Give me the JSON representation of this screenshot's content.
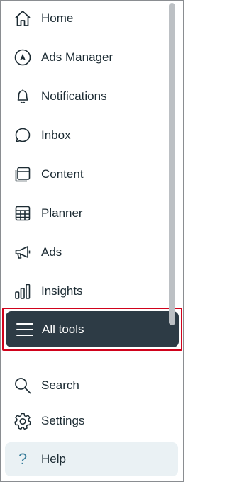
{
  "nav": {
    "items": [
      {
        "label": "Home",
        "icon": "home-icon"
      },
      {
        "label": "Ads Manager",
        "icon": "ads-manager-icon"
      },
      {
        "label": "Notifications",
        "icon": "bell-icon",
        "unread": true
      },
      {
        "label": "Inbox",
        "icon": "chat-bubble-icon",
        "unread": true
      },
      {
        "label": "Content",
        "icon": "content-icon"
      },
      {
        "label": "Planner",
        "icon": "calendar-grid-icon"
      },
      {
        "label": "Ads",
        "icon": "megaphone-icon"
      },
      {
        "label": "Insights",
        "icon": "bar-chart-icon"
      }
    ],
    "all_tools": {
      "label": "All tools",
      "icon": "menu-icon"
    }
  },
  "bottom": {
    "items": [
      {
        "label": "Search",
        "icon": "search-icon"
      },
      {
        "label": "Settings",
        "icon": "gear-icon"
      },
      {
        "label": "Help",
        "icon": "question-icon"
      }
    ]
  },
  "colors": {
    "text": "#1c2b33",
    "selected_bg": "#2d3b45",
    "highlight_outline": "#d0021b",
    "notification_dot": "#e41e3f",
    "help_bg": "#eaf1f4"
  }
}
